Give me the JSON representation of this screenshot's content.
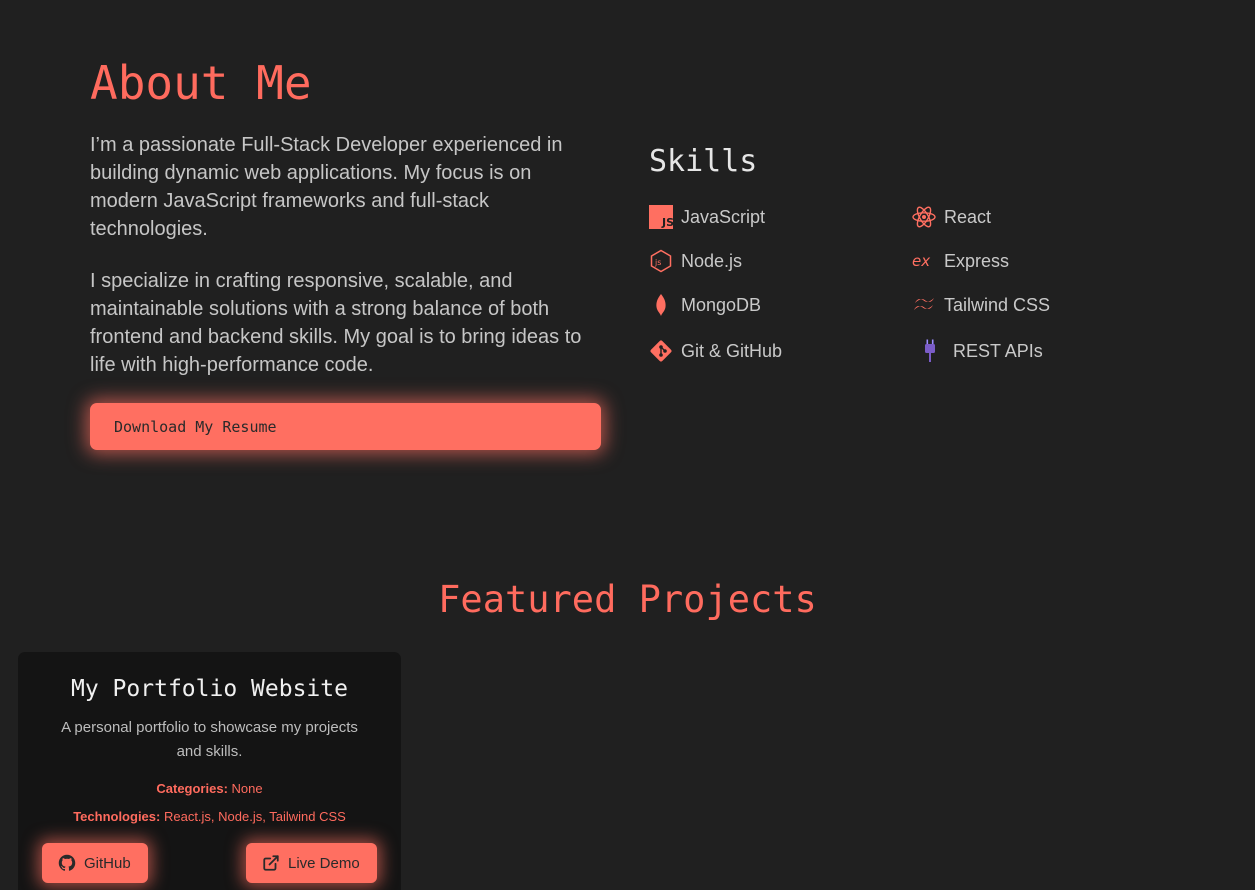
{
  "about": {
    "title": "About Me",
    "paragraph1": "I’m a passionate Full-Stack Developer experienced in building dynamic web applications. My focus is on modern JavaScript frameworks and full-stack technologies.",
    "paragraph2": "I specialize in crafting responsive, scalable, and maintainable solutions with a strong balance of both frontend and backend skills. My goal is to bring ideas to life with high-performance code.",
    "resume_button": "Download My Resume"
  },
  "skills": {
    "title": "Skills",
    "items": [
      {
        "label": "JavaScript",
        "icon": "javascript-icon"
      },
      {
        "label": "React",
        "icon": "react-icon"
      },
      {
        "label": "Node.js",
        "icon": "nodejs-icon"
      },
      {
        "label": "Express",
        "icon": "express-icon"
      },
      {
        "label": "MongoDB",
        "icon": "mongodb-icon"
      },
      {
        "label": "Tailwind CSS",
        "icon": "tailwind-icon"
      },
      {
        "label": "Git & GitHub",
        "icon": "git-icon"
      },
      {
        "label": "REST APIs",
        "icon": "plug-icon"
      }
    ]
  },
  "projects": {
    "title": "Featured Projects",
    "cards": [
      {
        "title": "My Portfolio Website",
        "description": "A personal portfolio to showcase my projects and skills.",
        "categories_label": "Categories:",
        "categories_value": "None",
        "technologies_label": "Technologies:",
        "technologies_value": "React.js, Node.js, Tailwind CSS",
        "github_button": "GitHub",
        "demo_button": "Live Demo"
      }
    ]
  },
  "colors": {
    "accent": "#ff6f61",
    "background": "#202020",
    "card": "#141414"
  }
}
